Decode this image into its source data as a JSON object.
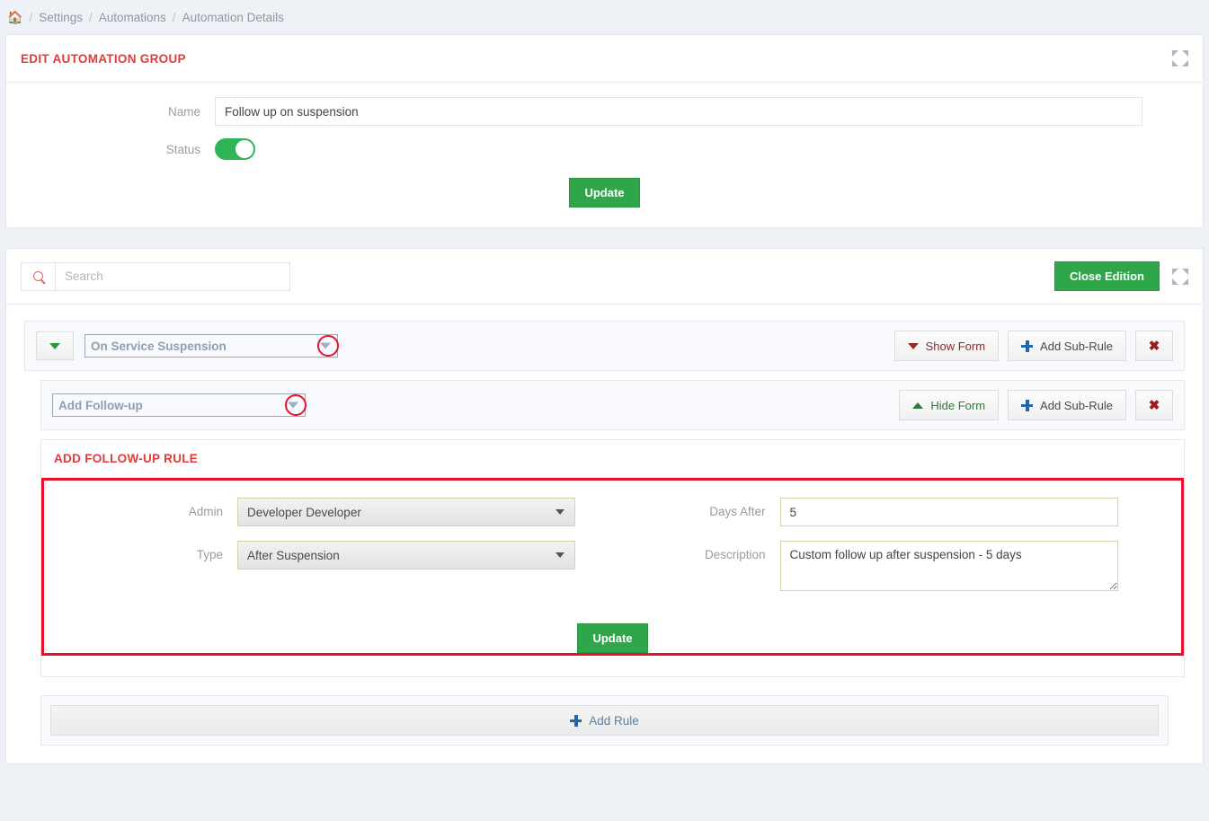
{
  "breadcrumb": {
    "home_icon": "home-icon",
    "items": [
      "Settings",
      "Automations",
      "Automation Details"
    ],
    "separator": "/"
  },
  "edit_group_panel": {
    "title": "EDIT AUTOMATION GROUP",
    "expand_icon": "expand-arrows-icon",
    "name_label": "Name",
    "name_value": "Follow up on suspension",
    "name_placeholder": "",
    "status_label": "Status",
    "status_on": true,
    "update_label": "Update"
  },
  "rules_panel": {
    "search_placeholder": "Search",
    "search_value": "",
    "search_icon": "search-icon",
    "close_edition_label": "Close Edition",
    "expand_icon": "expand-arrows-icon",
    "rules": [
      {
        "name": "On Service Suspension",
        "collapse_icon": "chevron-down-icon",
        "dropdown_icon": "chevron-down-icon",
        "form_toggle_label": "Show Form",
        "form_toggle_icon": "caret-down-icon",
        "add_sub_rule_label": "Add Sub-Rule",
        "add_icon": "plus-icon",
        "delete_icon": "✖"
      },
      {
        "name": "Add Follow-up",
        "dropdown_icon": "chevron-down-icon",
        "form_toggle_label": "Hide Form",
        "form_toggle_icon": "caret-up-icon",
        "add_sub_rule_label": "Add Sub-Rule",
        "add_icon": "plus-icon",
        "delete_icon": "✖"
      }
    ],
    "follow_up_form": {
      "title": "ADD FOLLOW-UP RULE",
      "admin_label": "Admin",
      "admin_value": "Developer Developer",
      "type_label": "Type",
      "type_value": "After Suspension",
      "days_after_label": "Days After",
      "days_after_value": "5",
      "description_label": "Description",
      "description_value": "Custom follow up after suspension - 5 days",
      "update_label": "Update"
    },
    "add_rule_label": "Add Rule",
    "add_rule_icon": "plus-icon"
  },
  "colors": {
    "accent_red": "#e03b3b",
    "annotation_red": "#e8112d",
    "green": "#30a64a",
    "toggle_green": "#2fb457",
    "blue": "#2566a8",
    "page_bg": "#eef1f5"
  }
}
